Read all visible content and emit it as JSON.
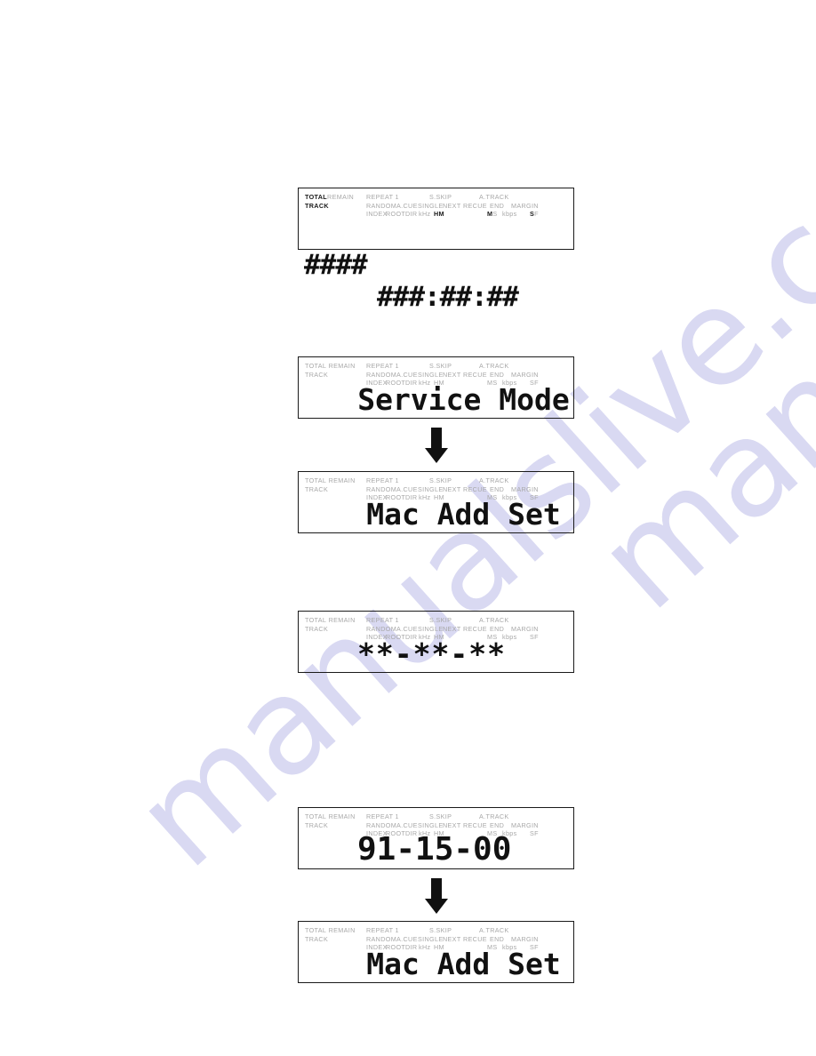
{
  "watermark": {
    "text": "manualslive.com",
    "color": "#d9d9f2"
  },
  "display": {
    "indicator_labels": {
      "row1": {
        "total": "TOTAL",
        "remain": "REMAIN",
        "repeat": "REPEAT 1",
        "sskip": "S.SKIP",
        "atrack": "A.TRACK"
      },
      "row2": {
        "track": "TRACK",
        "random": "RANDOM",
        "acue": "A.CUE",
        "single": "SINGLE",
        "next": "NEXT",
        "recue": "RECUE",
        "end": "END",
        "margin": "MARGIN"
      },
      "row3": {
        "index": "INDEX",
        "root": "ROOT",
        "dir": "DIR",
        "khz": "kHz",
        "hm": "HM",
        "ms": "MS",
        "kbps": "kbps",
        "sf": "SF"
      }
    }
  },
  "panels": [
    {
      "id": "panel-time-placeholder",
      "name": "time-display-placeholder",
      "readout_left": "####",
      "readout_right": "###:##:##",
      "active_indicators": [
        "TOTAL",
        "TRACK",
        "HM",
        "M",
        "S"
      ],
      "layout": "twopart"
    },
    {
      "id": "panel-service-mode",
      "name": "service-mode-display",
      "readout": "Service Mode",
      "active_indicators": [],
      "layout": "center"
    },
    {
      "id": "panel-mac-add-set-1",
      "name": "mac-address-set-display",
      "readout": "Mac Add Set",
      "active_indicators": [],
      "layout": "center"
    },
    {
      "id": "panel-mac-placeholder",
      "name": "mac-address-placeholder-display",
      "readout": "**-**-**",
      "active_indicators": [],
      "layout": "center-left"
    },
    {
      "id": "panel-mac-value",
      "name": "mac-address-value-display",
      "readout": "91-15-00",
      "active_indicators": [],
      "layout": "center-left"
    },
    {
      "id": "panel-mac-add-set-2",
      "name": "mac-address-set-display-2",
      "readout": "Mac Add Set",
      "active_indicators": [],
      "layout": "center"
    }
  ],
  "arrows": [
    {
      "id": "arrow-1",
      "name": "flow-arrow-down-1",
      "direction": "down"
    },
    {
      "id": "arrow-2",
      "name": "flow-arrow-down-2",
      "direction": "down"
    }
  ]
}
